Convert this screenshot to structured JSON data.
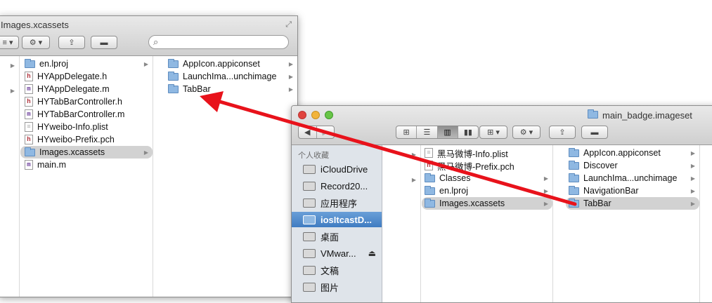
{
  "window_back": {
    "title": "Images.xcassets",
    "view_col1_items": [
      "",
      "",
      ""
    ],
    "col1": [
      {
        "label": "en.lproj",
        "icon": "folder-icon",
        "arrow": true
      },
      {
        "label": "HYAppDelegate.h",
        "icon": "h-file-icon",
        "arrow": false
      },
      {
        "label": "HYAppDelegate.m",
        "icon": "m-file-icon",
        "arrow": false
      },
      {
        "label": "HYTabBarController.h",
        "icon": "h-file-icon",
        "arrow": false
      },
      {
        "label": "HYTabBarController.m",
        "icon": "m-file-icon",
        "arrow": false
      },
      {
        "label": "HYweibo-Info.plist",
        "icon": "plist-file-icon",
        "arrow": false
      },
      {
        "label": "HYweibo-Prefix.pch",
        "icon": "h-file-icon",
        "arrow": false
      },
      {
        "label": "Images.xcassets",
        "icon": "folder-icon",
        "arrow": true,
        "selected": true
      },
      {
        "label": "main.m",
        "icon": "m-file-icon",
        "arrow": false
      }
    ],
    "col2": [
      {
        "label": "AppIcon.appiconset",
        "icon": "folder-icon",
        "arrow": true
      },
      {
        "label": "LaunchIma...unchimage",
        "icon": "folder-icon",
        "arrow": true
      },
      {
        "label": "TabBar",
        "icon": "folder-icon",
        "arrow": true
      }
    ]
  },
  "window_front": {
    "title": "main_badge.imageset",
    "sidebar_header": "个人收藏",
    "sidebar": [
      {
        "label": "iCloudDrive",
        "icon": "cloud-drive-icon"
      },
      {
        "label": "Record20...",
        "icon": "folder-icon"
      },
      {
        "label": "应用程序",
        "icon": "applications-icon"
      },
      {
        "label": "iosItcastD...",
        "icon": "folder-icon",
        "selected": true
      },
      {
        "label": "桌面",
        "icon": "desktop-icon"
      },
      {
        "label": "VMwar...",
        "icon": "drive-icon",
        "eject": "⏏"
      },
      {
        "label": "文稿",
        "icon": "documents-icon"
      },
      {
        "label": "图片",
        "icon": "pictures-icon"
      }
    ],
    "col2": [
      {
        "label": "黑马微博-Info.plist",
        "icon": "plist-file-icon",
        "arrow": false
      },
      {
        "label": "黑马微博-Prefix.pch",
        "icon": "h-file-icon",
        "arrow": false
      },
      {
        "label": "Classes",
        "icon": "folder-icon",
        "arrow": true
      },
      {
        "label": "en.lproj",
        "icon": "folder-icon",
        "arrow": true
      },
      {
        "label": "Images.xcassets",
        "icon": "folder-icon",
        "arrow": true,
        "selected": true
      }
    ],
    "col3": [
      {
        "label": "AppIcon.appiconset",
        "icon": "folder-icon",
        "arrow": true
      },
      {
        "label": "Discover",
        "icon": "folder-icon",
        "arrow": true
      },
      {
        "label": "LaunchIma...unchimage",
        "icon": "folder-icon",
        "arrow": true
      },
      {
        "label": "NavigationBar",
        "icon": "folder-icon",
        "arrow": true
      },
      {
        "label": "TabBar",
        "icon": "folder-icon",
        "arrow": true,
        "selected": true
      }
    ]
  },
  "colors": {
    "arrow": "#e8121b",
    "selection_blue": "#3f7cc2"
  }
}
